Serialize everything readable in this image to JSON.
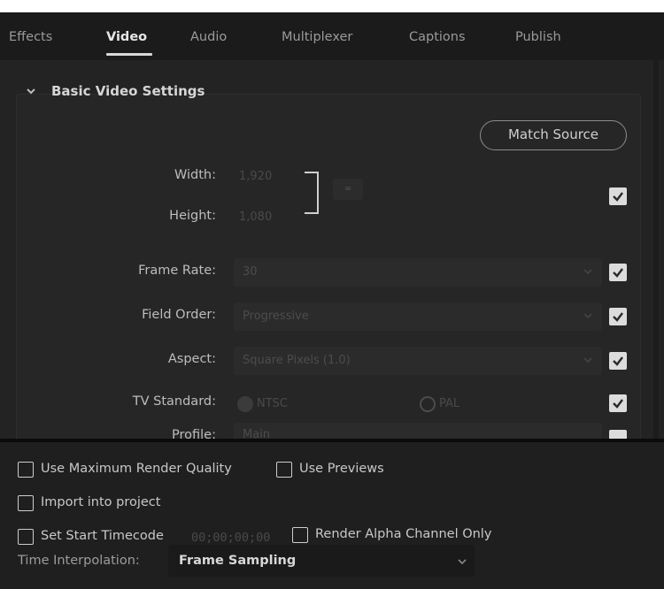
{
  "tabs": [
    {
      "label": "Effects"
    },
    {
      "label": "Video"
    },
    {
      "label": "Audio"
    },
    {
      "label": "Multiplexer"
    },
    {
      "label": "Captions"
    },
    {
      "label": "Publish"
    }
  ],
  "active_tab": "Video",
  "section": {
    "title": "Basic Video Settings",
    "match_source": "Match Source"
  },
  "fields": {
    "width_label": "Width:",
    "width_value": "1,920",
    "height_label": "Height:",
    "height_value": "1,080",
    "frame_rate_label": "Frame Rate:",
    "frame_rate_value": "30",
    "field_order_label": "Field Order:",
    "field_order_value": "Progressive",
    "aspect_label": "Aspect:",
    "aspect_value": "Square Pixels (1.0)",
    "tv_standard_label": "TV Standard:",
    "tv_ntsc": "NTSC",
    "tv_pal": "PAL",
    "profile_label": "Profile:",
    "profile_value": "Main"
  },
  "bottom": {
    "max_render_quality": "Use Maximum Render Quality",
    "use_previews": "Use Previews",
    "import_into_project": "Import into project",
    "set_start_timecode": "Set Start Timecode",
    "timecode_value": "00;00;00;00",
    "render_alpha_only": "Render Alpha Channel Only",
    "time_interpolation_label": "Time Interpolation:",
    "time_interpolation_value": "Frame Sampling"
  },
  "icons": {
    "collapse": "chevron-down-icon",
    "link": "link-icon",
    "dropdown": "chevron-down-icon",
    "check": "checkmark-icon"
  },
  "colors": {
    "background": "#1e1e1e",
    "panel": "#232323",
    "text": "#bdbdbd",
    "active_tab": "#e6e6e6"
  }
}
